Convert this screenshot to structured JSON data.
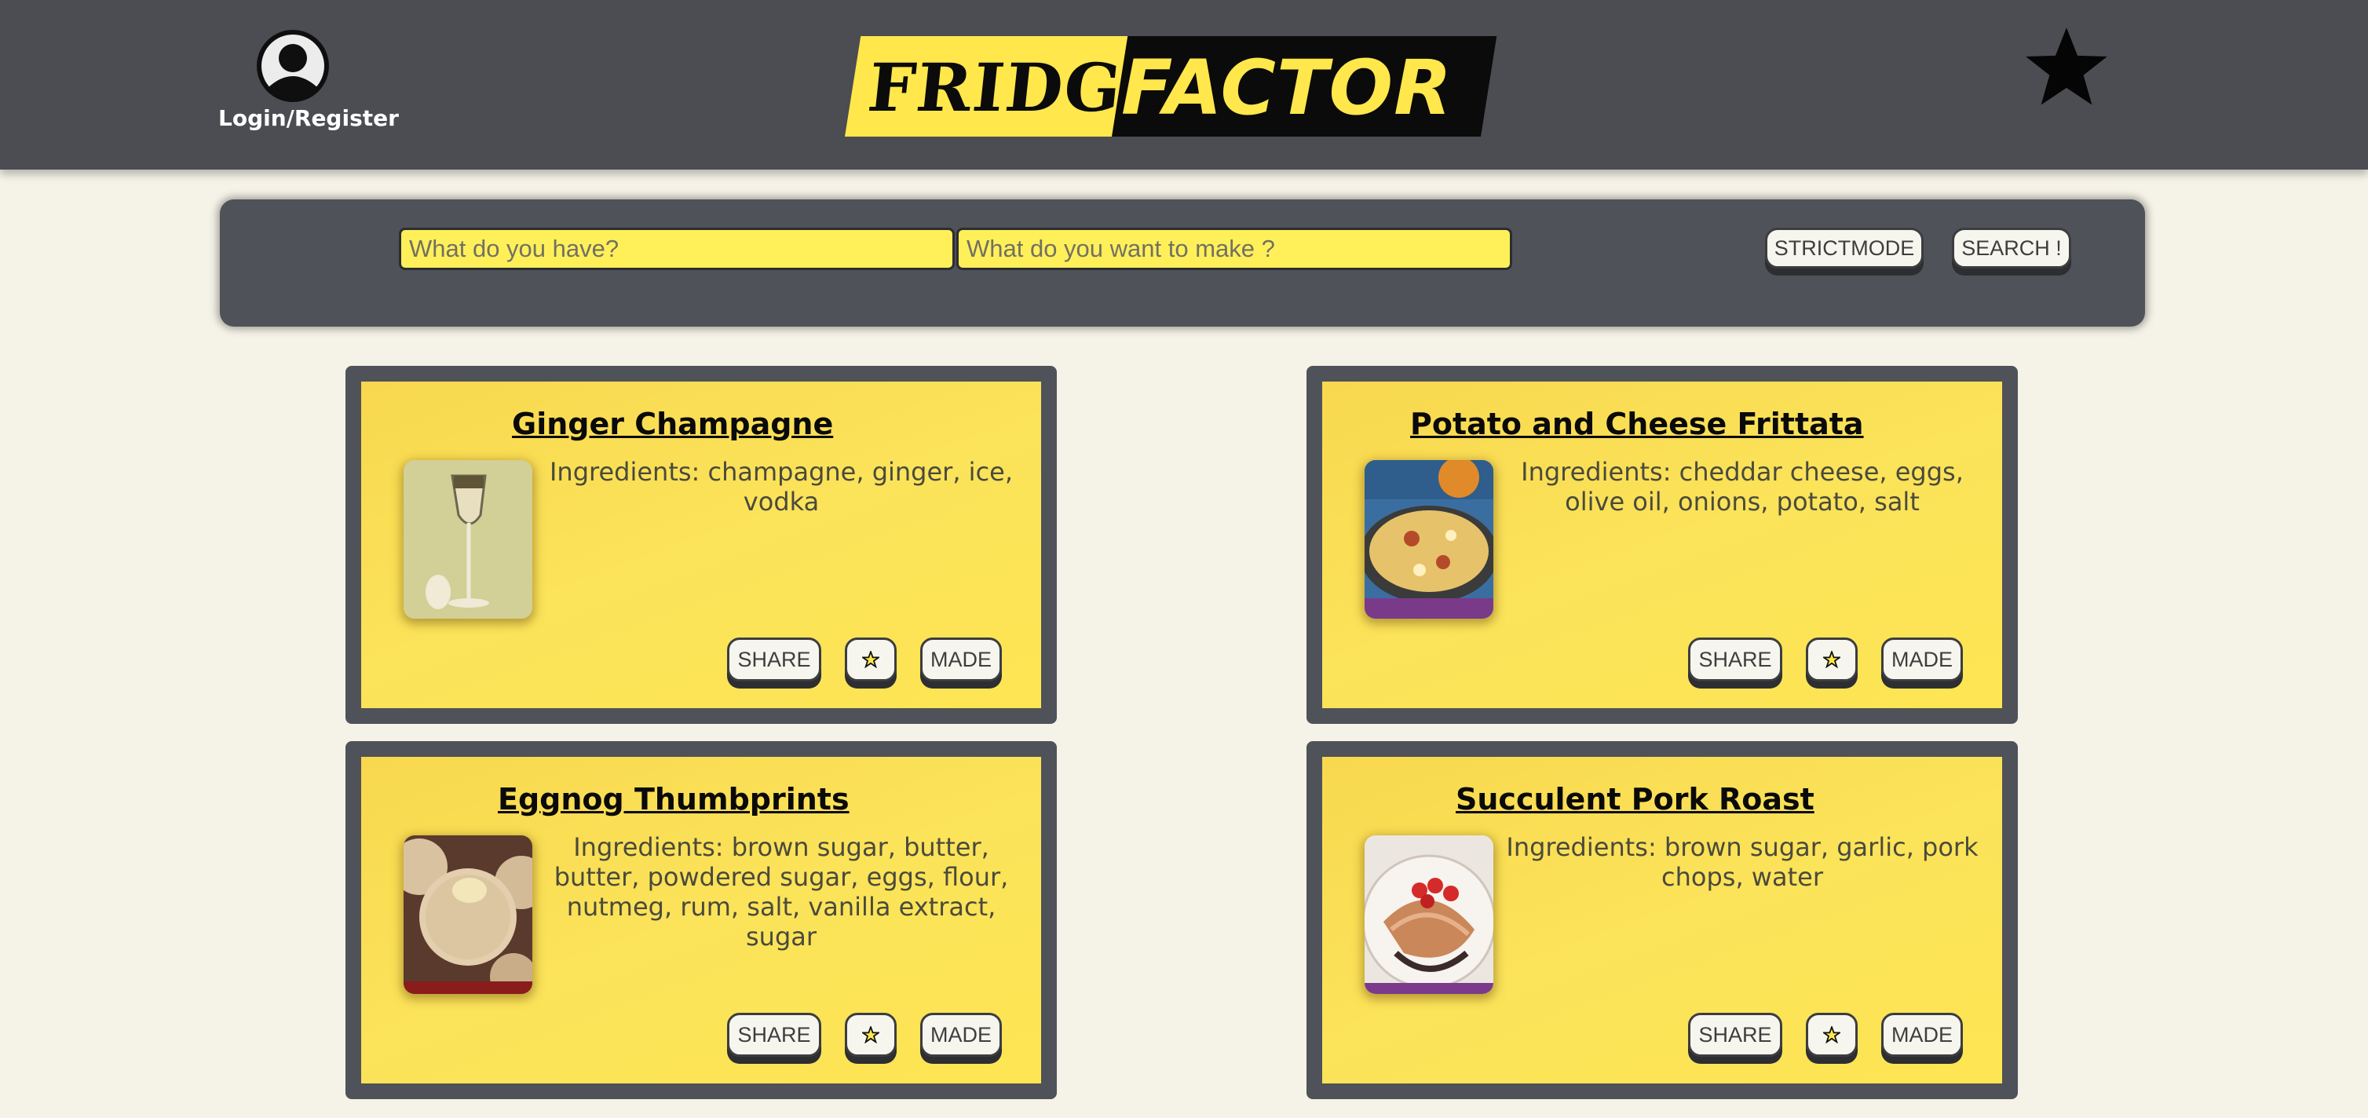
{
  "header": {
    "login_label": "Login/Register",
    "logo_part1": "FRIDGE",
    "logo_part2": "FACTOR",
    "icons": {
      "avatar": "user-avatar-icon",
      "favorites": "star-icon"
    }
  },
  "search": {
    "have_placeholder": "What do you have?",
    "want_placeholder": "What do you want to make ?",
    "strictmode_label": "STRICTMODE",
    "search_label": "SEARCH !"
  },
  "recipes": [
    {
      "title": "Ginger Champagne",
      "ingredients": "Ingredients: champagne, ginger, ice, vodka",
      "share": "SHARE",
      "made": "MADE",
      "fav_icon": "star-icon"
    },
    {
      "title": "Potato and Cheese Frittata",
      "ingredients": "Ingredients: cheddar cheese, eggs, olive oil, onions, potato, salt",
      "share": "SHARE",
      "made": "MADE",
      "fav_icon": "star-icon"
    },
    {
      "title": "Eggnog Thumbprints",
      "ingredients": "Ingredients: brown sugar, butter, butter, powdered sugar, eggs, flour, nutmeg, rum, salt, vanilla extract, sugar",
      "share": "SHARE",
      "made": "MADE",
      "fav_icon": "star-icon"
    },
    {
      "title": "Succulent Pork Roast",
      "ingredients": "Ingredients: brown sugar, garlic, pork chops, water",
      "share": "SHARE",
      "made": "MADE",
      "fav_icon": "star-icon"
    }
  ],
  "colors": {
    "header_bg": "#4b4d52",
    "page_bg": "#f5f2e7",
    "accent_yellow": "#ffe74c",
    "panel_gray": "#4f5258"
  }
}
